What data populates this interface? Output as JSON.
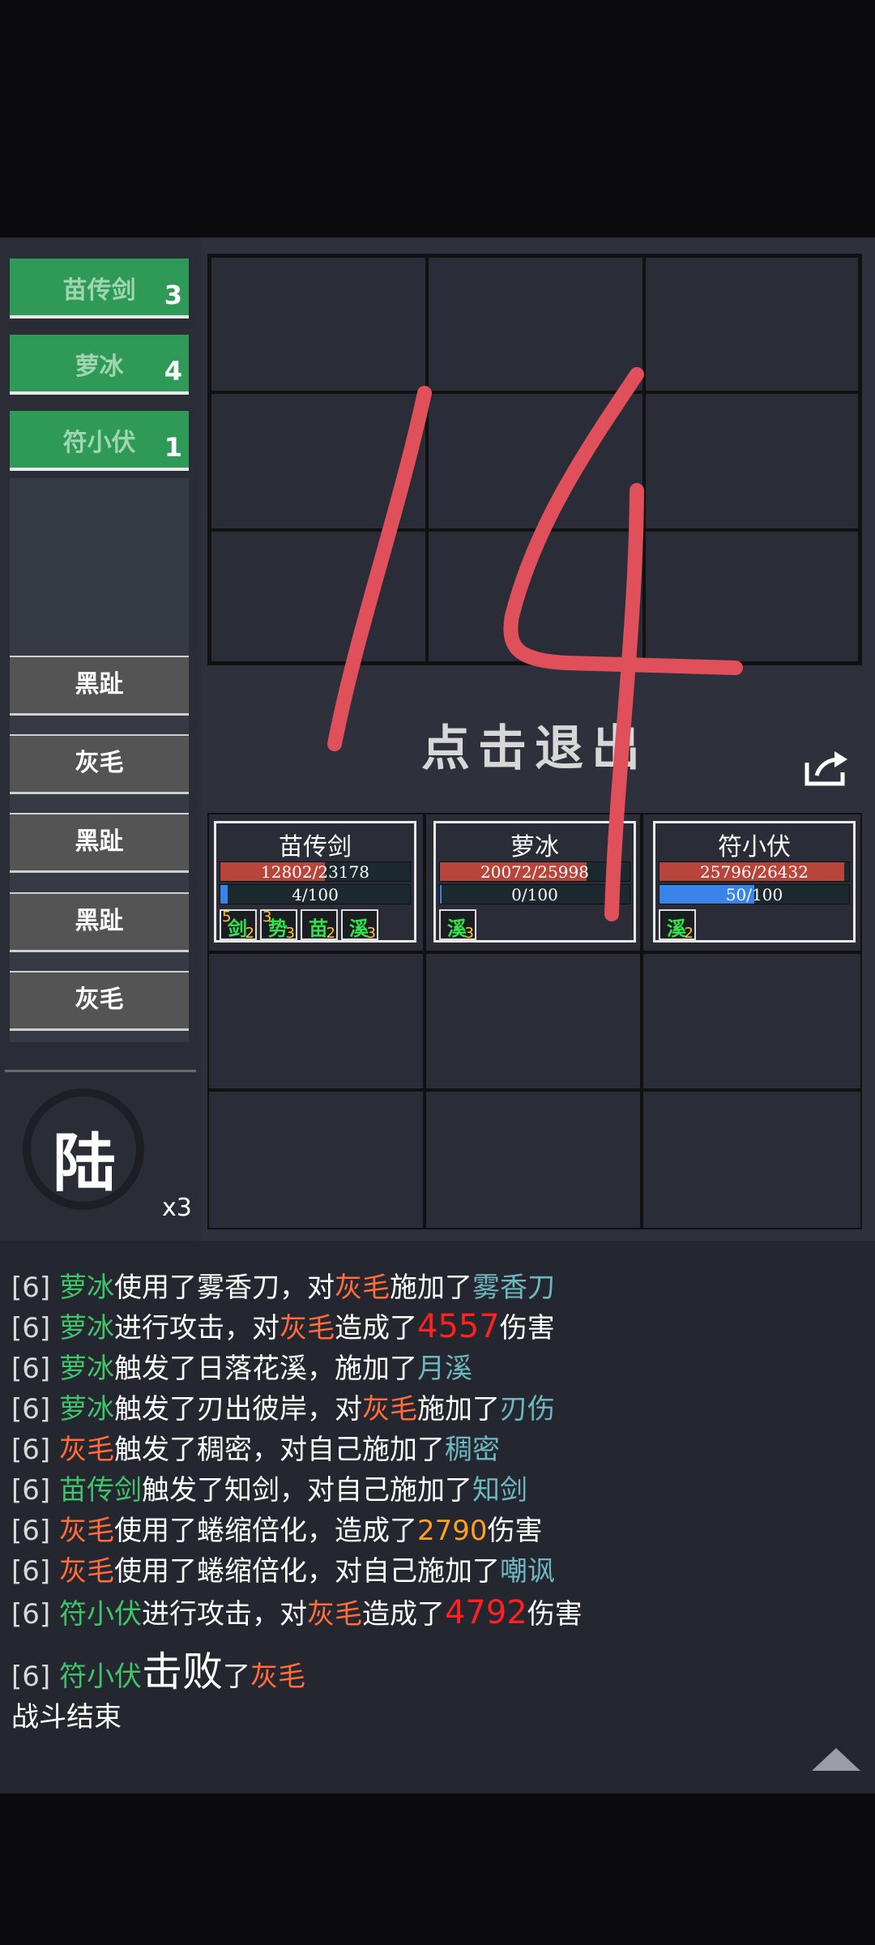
{
  "allies": [
    {
      "name": "苗传剑",
      "count": "3"
    },
    {
      "name": "萝冰",
      "count": "4"
    },
    {
      "name": "符小伏",
      "count": "1"
    }
  ],
  "enemies": [
    "黑趾",
    "灰毛",
    "黑趾",
    "黑趾",
    "灰毛"
  ],
  "stage": {
    "char": "陆",
    "speed": "x3"
  },
  "exit_text": "点击退出",
  "overlay_number": "14",
  "units": [
    {
      "name": "苗传剑",
      "hp_text": "12802/23178",
      "hp_frac": 0.552,
      "mp_text": "4/100",
      "mp_frac": 0.04,
      "buffs": [
        {
          "glyph": "剑",
          "level": "5",
          "stacks": "2"
        },
        {
          "glyph": "势",
          "level": "3",
          "stacks": "3"
        },
        {
          "glyph": "苗",
          "level": "",
          "stacks": "2"
        },
        {
          "glyph": "溪",
          "level": "",
          "stacks": "3"
        }
      ]
    },
    {
      "name": "萝冰",
      "hp_text": "20072/25998",
      "hp_frac": 0.772,
      "mp_text": "0/100",
      "mp_frac": 0.0,
      "buffs": [
        {
          "glyph": "溪",
          "level": "",
          "stacks": "3"
        }
      ]
    },
    {
      "name": "符小伏",
      "hp_text": "25796/26432",
      "hp_frac": 0.976,
      "mp_text": "50/100",
      "mp_frac": 0.5,
      "buffs": [
        {
          "glyph": "溪",
          "level": "",
          "stacks": "2"
        }
      ]
    }
  ],
  "log": [
    [
      {
        "c": "t",
        "s": "[6] "
      },
      {
        "c": "ally-c",
        "s": "萝冰"
      },
      {
        "c": "",
        "s": "使用了雾香刀，对"
      },
      {
        "c": "enemy-c",
        "s": "灰毛"
      },
      {
        "c": "",
        "s": "施加了"
      },
      {
        "c": "eff-c",
        "s": "雾香刀"
      }
    ],
    [
      {
        "c": "t",
        "s": "[6] "
      },
      {
        "c": "ally-c",
        "s": "萝冰"
      },
      {
        "c": "",
        "s": "进行攻击，对"
      },
      {
        "c": "enemy-c",
        "s": "灰毛"
      },
      {
        "c": "",
        "s": "造成了"
      },
      {
        "c": "dmg-r",
        "s": "4557"
      },
      {
        "c": "",
        "s": "伤害"
      }
    ],
    [
      {
        "c": "t",
        "s": "[6] "
      },
      {
        "c": "ally-c",
        "s": "萝冰"
      },
      {
        "c": "",
        "s": "触发了日落花溪，施加了"
      },
      {
        "c": "eff-c",
        "s": "月溪"
      }
    ],
    [
      {
        "c": "t",
        "s": "[6] "
      },
      {
        "c": "ally-c",
        "s": "萝冰"
      },
      {
        "c": "",
        "s": "触发了刃出彼岸，对"
      },
      {
        "c": "enemy-c",
        "s": "灰毛"
      },
      {
        "c": "",
        "s": "施加了"
      },
      {
        "c": "eff-c",
        "s": "刃伤"
      }
    ],
    [
      {
        "c": "t",
        "s": "[6] "
      },
      {
        "c": "enemy-c",
        "s": "灰毛"
      },
      {
        "c": "",
        "s": "触发了稠密，对自己施加了"
      },
      {
        "c": "eff-c",
        "s": "稠密"
      }
    ],
    [
      {
        "c": "t",
        "s": "[6] "
      },
      {
        "c": "ally-c",
        "s": "苗传剑"
      },
      {
        "c": "",
        "s": "触发了知剑，对自己施加了"
      },
      {
        "c": "eff-c",
        "s": "知剑"
      }
    ],
    [
      {
        "c": "t",
        "s": "[6] "
      },
      {
        "c": "enemy-c",
        "s": "灰毛"
      },
      {
        "c": "",
        "s": "使用了蜷缩倍化，造成了"
      },
      {
        "c": "dmg-o",
        "s": "2790"
      },
      {
        "c": "",
        "s": "伤害"
      }
    ],
    [
      {
        "c": "t",
        "s": "[6] "
      },
      {
        "c": "enemy-c",
        "s": "灰毛"
      },
      {
        "c": "",
        "s": "使用了蜷缩倍化，对自己施加了"
      },
      {
        "c": "eff-c",
        "s": "嘲讽"
      }
    ],
    [
      {
        "c": "t",
        "s": "[6] "
      },
      {
        "c": "ally-c",
        "s": "符小伏"
      },
      {
        "c": "",
        "s": "进行攻击，对"
      },
      {
        "c": "enemy-c",
        "s": "灰毛"
      },
      {
        "c": "",
        "s": "造成了"
      },
      {
        "c": "dmg-r",
        "s": "4792"
      },
      {
        "c": "",
        "s": "伤害"
      }
    ],
    [
      {
        "c": "t",
        "s": "[6] "
      },
      {
        "c": "ally-c",
        "s": "符小伏"
      },
      {
        "c": "big",
        "s": "击败"
      },
      {
        "c": "",
        "s": "了"
      },
      {
        "c": "enemy-c",
        "s": "灰毛"
      }
    ]
  ],
  "end_text": "战斗结束"
}
